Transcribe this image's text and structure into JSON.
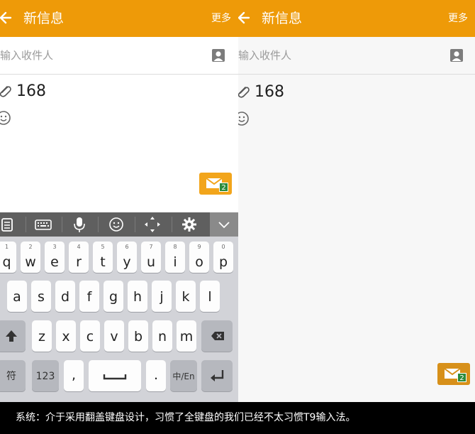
{
  "left": {
    "header": {
      "title": "新信息",
      "more_label": "更多"
    },
    "recipient": {
      "placeholder": "输入收件人"
    },
    "composer": {
      "message": "168"
    },
    "send": {
      "badge": "2"
    },
    "keyboard": {
      "row1": [
        {
          "char": "q",
          "num": "1"
        },
        {
          "char": "w",
          "num": "2"
        },
        {
          "char": "e",
          "num": "3"
        },
        {
          "char": "r",
          "num": "4"
        },
        {
          "char": "t",
          "num": "5"
        },
        {
          "char": "y",
          "num": "6"
        },
        {
          "char": "u",
          "num": "7"
        },
        {
          "char": "i",
          "num": "8"
        },
        {
          "char": "o",
          "num": "9"
        },
        {
          "char": "p",
          "num": "0"
        }
      ],
      "row2": [
        "a",
        "s",
        "d",
        "f",
        "g",
        "h",
        "j",
        "k",
        "l"
      ],
      "row3": [
        "z",
        "x",
        "c",
        "v",
        "b",
        "n",
        "m"
      ],
      "symbol_label": "符",
      "numbers_label": "123",
      "comma_label": ",",
      "period_label": ".",
      "lang_label": "中/En"
    }
  },
  "right": {
    "header": {
      "title": "新信息",
      "more_label": "更多"
    },
    "recipient": {
      "placeholder": "输入收件人"
    },
    "composer": {
      "message": "168"
    },
    "send": {
      "badge": "2"
    }
  },
  "caption": "系统：介于采用翻盖键盘设计，习惯了全键盘的我们已经不太习惯T9输入法。",
  "colors": {
    "appbar": "#ee9a08",
    "send_button": "#f2a51b",
    "keyboard_toolbar": "#5f5f5f",
    "keyboard_bg": "#d2d3d8",
    "badge": "#2c8b3b"
  }
}
